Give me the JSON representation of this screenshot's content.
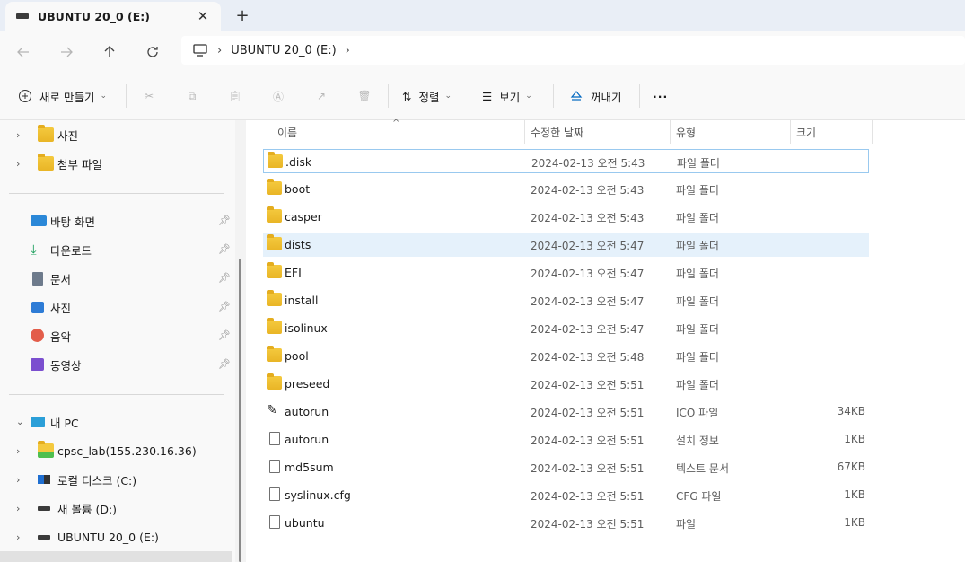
{
  "tab": {
    "title": "UBUNTU 20_0 (E:)",
    "close": "✕",
    "new": "+"
  },
  "address": {
    "crumb": "UBUNTU 20_0 (E:)",
    "sep": "›"
  },
  "toolbar": {
    "new_label": "새로 만들기",
    "sort_label": "정렬",
    "view_label": "보기",
    "eject_label": "꺼내기",
    "more": "···"
  },
  "sidebar": {
    "top": [
      {
        "label": "사진"
      },
      {
        "label": "첨부 파일"
      }
    ],
    "quick": [
      {
        "label": "바탕 화면",
        "icon": "desktop-icon"
      },
      {
        "label": "다운로드",
        "icon": "download-icon"
      },
      {
        "label": "문서",
        "icon": "document-icon"
      },
      {
        "label": "사진",
        "icon": "pictures-icon"
      },
      {
        "label": "음악",
        "icon": "music-icon"
      },
      {
        "label": "동영상",
        "icon": "video-icon"
      }
    ],
    "pc": {
      "label": "내 PC"
    },
    "drives": [
      {
        "label": "cpsc_lab(155.230.16.36)"
      },
      {
        "label": "로컬 디스크 (C:)"
      },
      {
        "label": "새 볼륨 (D:)"
      },
      {
        "label": "UBUNTU 20_0 (E:)"
      }
    ]
  },
  "columns": {
    "name": "이름",
    "date": "수정한 날짜",
    "type": "유형",
    "size": "크기"
  },
  "files": [
    {
      "name": ".disk",
      "date": "2024-02-13 오전 5:43",
      "type": "파일 폴더",
      "size": "",
      "kind": "folder"
    },
    {
      "name": "boot",
      "date": "2024-02-13 오전 5:43",
      "type": "파일 폴더",
      "size": "",
      "kind": "folder"
    },
    {
      "name": "casper",
      "date": "2024-02-13 오전 5:43",
      "type": "파일 폴더",
      "size": "",
      "kind": "folder"
    },
    {
      "name": "dists",
      "date": "2024-02-13 오전 5:47",
      "type": "파일 폴더",
      "size": "",
      "kind": "folder"
    },
    {
      "name": "EFI",
      "date": "2024-02-13 오전 5:47",
      "type": "파일 폴더",
      "size": "",
      "kind": "folder"
    },
    {
      "name": "install",
      "date": "2024-02-13 오전 5:47",
      "type": "파일 폴더",
      "size": "",
      "kind": "folder"
    },
    {
      "name": "isolinux",
      "date": "2024-02-13 오전 5:47",
      "type": "파일 폴더",
      "size": "",
      "kind": "folder"
    },
    {
      "name": "pool",
      "date": "2024-02-13 오전 5:48",
      "type": "파일 폴더",
      "size": "",
      "kind": "folder"
    },
    {
      "name": "preseed",
      "date": "2024-02-13 오전 5:51",
      "type": "파일 폴더",
      "size": "",
      "kind": "folder"
    },
    {
      "name": "autorun",
      "date": "2024-02-13 오전 5:51",
      "type": "ICO 파일",
      "size": "34KB",
      "kind": "ico"
    },
    {
      "name": "autorun",
      "date": "2024-02-13 오전 5:51",
      "type": "설치 정보",
      "size": "1KB",
      "kind": "inf"
    },
    {
      "name": "md5sum",
      "date": "2024-02-13 오전 5:51",
      "type": "텍스트 문서",
      "size": "67KB",
      "kind": "txt"
    },
    {
      "name": "syslinux.cfg",
      "date": "2024-02-13 오전 5:51",
      "type": "CFG 파일",
      "size": "1KB",
      "kind": "file"
    },
    {
      "name": "ubuntu",
      "date": "2024-02-13 오전 5:51",
      "type": "파일",
      "size": "1KB",
      "kind": "file"
    }
  ],
  "colors": {
    "folder": "#f0c038",
    "selected": "#e5f1fb",
    "focus": "#99c9ef",
    "accent": "#0067c0"
  }
}
